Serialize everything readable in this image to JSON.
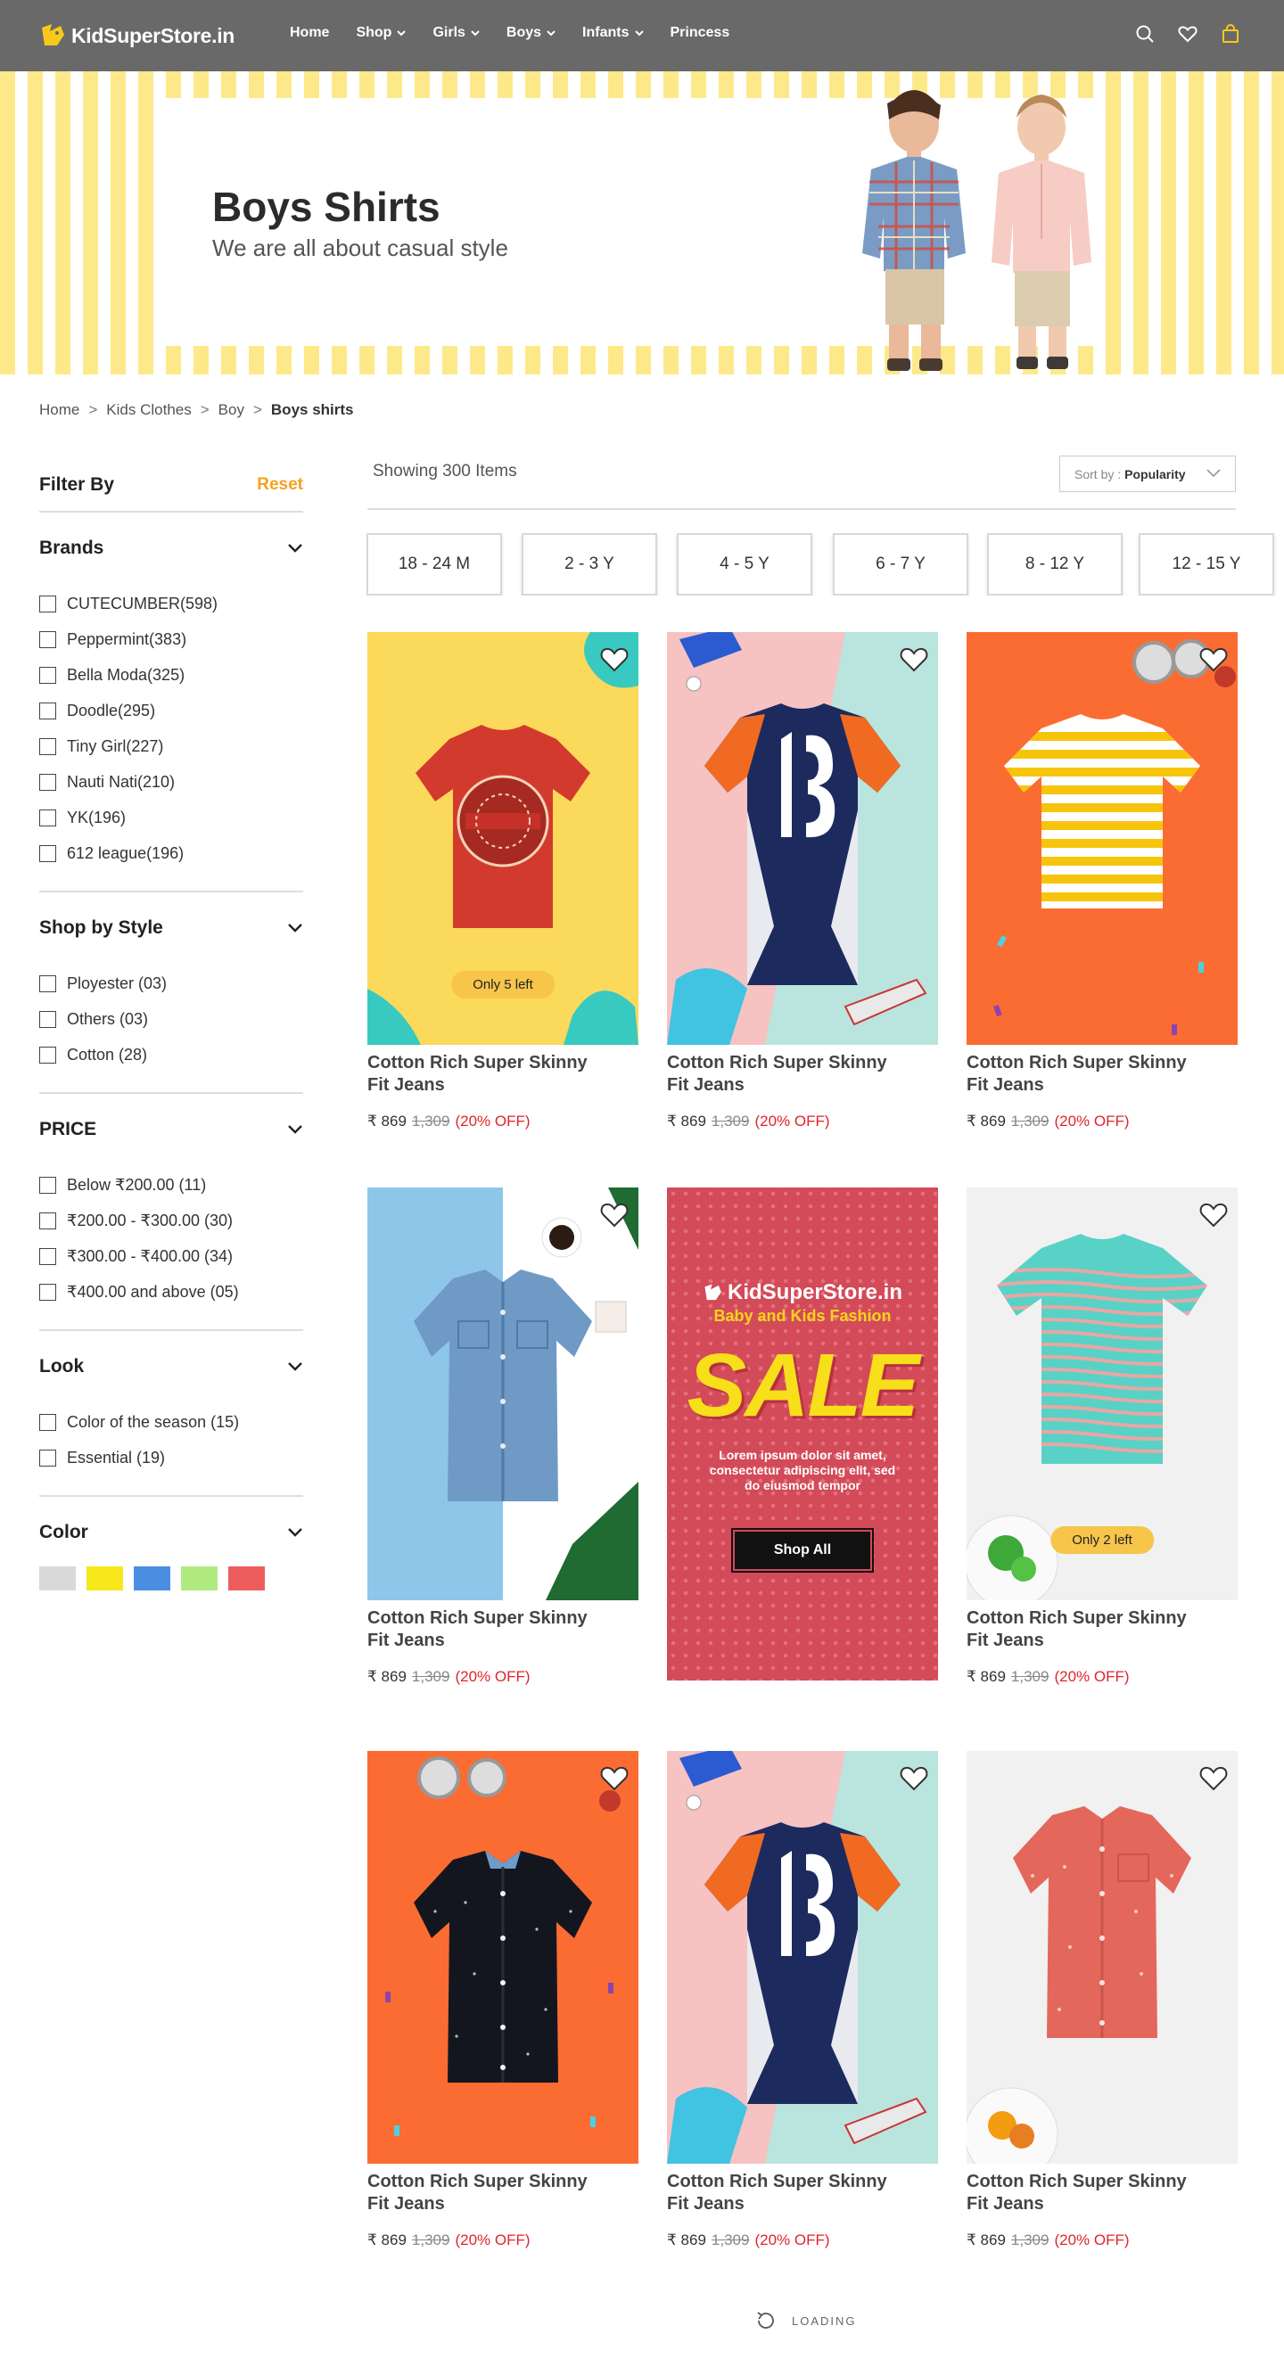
{
  "header": {
    "logo_text": "KidSuperStore.in",
    "nav": [
      {
        "label": "Home",
        "has_dropdown": false
      },
      {
        "label": "Shop",
        "has_dropdown": true
      },
      {
        "label": "Girls",
        "has_dropdown": true
      },
      {
        "label": "Boys",
        "has_dropdown": true
      },
      {
        "label": "Infants",
        "has_dropdown": true
      },
      {
        "label": "Princess",
        "has_dropdown": false
      }
    ],
    "icons": [
      "search-icon",
      "heart-icon",
      "shopping-bag-icon"
    ]
  },
  "banner": {
    "title": "Boys Shirts",
    "subtitle": "We are all about casual style"
  },
  "breadcrumb": [
    "Home",
    "Kids Clothes",
    "Boy",
    "Boys shirts"
  ],
  "sidebar": {
    "title": "Filter By",
    "reset": "Reset",
    "sections": {
      "brands": {
        "title": "Brands",
        "options": [
          "CUTECUMBER(598)",
          "Peppermint(383)",
          "Bella Moda(325)",
          "Doodle(295)",
          "Tiny Girl(227)",
          "Nauti Nati(210)",
          "YK(196)",
          "612 league(196)"
        ]
      },
      "style": {
        "title": "Shop by Style",
        "options": [
          "Ployester (03)",
          "Others (03)",
          "Cotton (28)"
        ]
      },
      "price": {
        "title": "PRICE",
        "options": [
          "Below ₹200.00 (11)",
          "₹200.00 - ₹300.00 (30)",
          "₹300.00 - ₹400.00 (34)",
          "₹400.00 and above (05)"
        ]
      },
      "look": {
        "title": "Look",
        "options": [
          "Color of the season (15)",
          "Essential (19)"
        ]
      },
      "color": {
        "title": "Color",
        "swatches": [
          "#d9d9d9",
          "#f7e81c",
          "#4a8fe2",
          "#b2ea82",
          "#ee5d5d"
        ]
      }
    }
  },
  "listing": {
    "showing": "Showing 300 Items",
    "sort_label": "Sort by :",
    "sort_value": "Popularity",
    "age_filters": [
      "18 - 24 M",
      "2 - 3 Y",
      "4 - 5 Y",
      "6 - 7 Y",
      "8 - 12 Y",
      "12 - 15 Y"
    ]
  },
  "products": [
    {
      "name": "Cotton Rich Super Skinny Fit Jeans",
      "price": "₹ 869",
      "mrp": "1,309",
      "discount": "(20% OFF)",
      "stock": "Only 5 left",
      "art": "red-tee"
    },
    {
      "name": "Cotton Rich Super Skinny Fit Jeans",
      "price": "₹ 869",
      "mrp": "1,309",
      "discount": "(20% OFF)",
      "stock": "",
      "art": "jersey"
    },
    {
      "name": "Cotton Rich Super Skinny Fit Jeans",
      "price": "₹ 869",
      "mrp": "1,309",
      "discount": "(20% OFF)",
      "stock": "",
      "art": "striped-tee"
    },
    {
      "name": "Cotton Rich Super Skinny Fit Jeans",
      "price": "₹ 869",
      "mrp": "1,309",
      "discount": "(20% OFF)",
      "stock": "",
      "art": "denim-shirt"
    },
    {
      "name": "Cotton Rich Super Skinny Fit Jeans",
      "price": "₹ 869",
      "mrp": "1,309",
      "discount": "(20% OFF)",
      "stock": "Only 2 left",
      "art": "teal-tee"
    },
    {
      "name": "Cotton Rich Super Skinny Fit Jeans",
      "price": "₹ 869",
      "mrp": "1,309",
      "discount": "(20% OFF)",
      "stock": "",
      "art": "black-shirt"
    },
    {
      "name": "Cotton Rich Super Skinny Fit Jeans",
      "price": "₹ 869",
      "mrp": "1,309",
      "discount": "(20% OFF)",
      "stock": "",
      "art": "jersey"
    },
    {
      "name": "Cotton Rich Super Skinny Fit Jeans",
      "price": "₹ 869",
      "mrp": "1,309",
      "discount": "(20% OFF)",
      "stock": "",
      "art": "coral-shirt"
    }
  ],
  "promo": {
    "logo": "KidSuperStore.in",
    "tagline": "Baby and Kids Fashion",
    "headline": "SALE",
    "text": "Lorem ipsum dolor sit amet, consectetur adipiscing elit, sed do eiusmod tempor",
    "button": "Shop All"
  },
  "loading": "LOADING"
}
